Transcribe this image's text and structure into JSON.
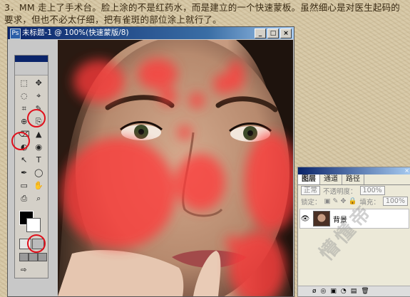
{
  "caption": "3．MM 走上了手术台。脸上涂的不是红药水，而是建立的一个快速蒙板。虽然细心是对医生起码的要求，但也不必太仔细，把有雀斑的部位涂上就行了。",
  "document": {
    "title": "未标题-1 @ 100%(快速蒙版/8)",
    "window_buttons": [
      "_",
      "□",
      "×"
    ]
  },
  "toolbox": {
    "tools": [
      "⬚",
      "✥",
      "◌",
      "⌖",
      "⌗",
      "✎",
      "⊕",
      "⎘",
      "⌫",
      "▲",
      "◐",
      "◉",
      "↖",
      "T",
      "✒",
      "◯",
      "▭",
      "✋",
      "⎙",
      "⌕"
    ],
    "modes": [
      "□",
      "◉"
    ],
    "jump": "⇨"
  },
  "annotations": [
    "brush-tool",
    "eraser-tool",
    "quick-mask-mode"
  ],
  "layers_panel": {
    "tabs": [
      "图层",
      "通道",
      "路径"
    ],
    "blend_mode": "正常",
    "opacity_label": "不透明度：",
    "opacity_value": "100%",
    "lock_label": "锁定：",
    "fill_label": "填充：",
    "fill_value": "100%",
    "layer_name": "背景",
    "bottom_icons": [
      "ø",
      "◎",
      "▣",
      "◔",
      "▤",
      "🗑"
    ]
  },
  "watermark": "懵懂帝"
}
